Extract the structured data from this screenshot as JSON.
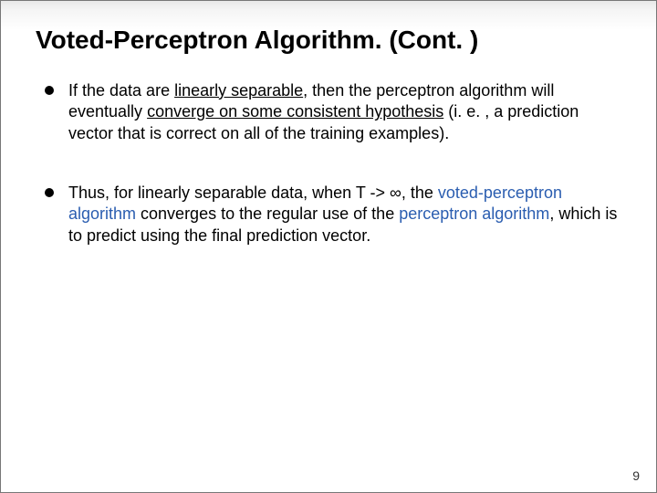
{
  "title": "Voted-Perceptron Algorithm. (Cont. )",
  "bullets": [
    {
      "pre": "If the data are ",
      "u1": "linearly separable",
      "mid1": ", then the perceptron algorithm will eventually ",
      "u2": "converge on some consistent hypothesis",
      "post": " (i. e. , a prediction vector that is correct on all of the training examples)."
    },
    {
      "pre": "Thus, for linearly separable data, when T -> ∞, the ",
      "link1": "voted-perceptron algorithm",
      "mid1": " converges to the regular use of the ",
      "link2": "perceptron algorithm",
      "post": ", which is to predict using the final prediction vector."
    }
  ],
  "page_number": "9"
}
